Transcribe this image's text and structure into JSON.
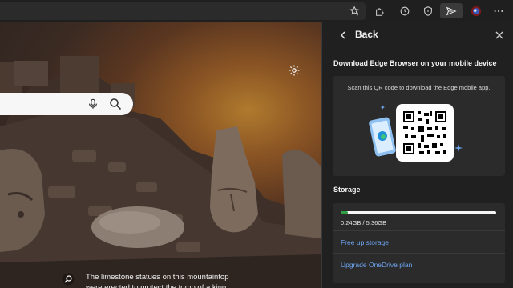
{
  "toolbar": {
    "icons": [
      "favorites-star-icon",
      "extensions-icon",
      "history-icon",
      "browser-essentials-icon",
      "send-share-icon",
      "profile-icon",
      "more-icon"
    ]
  },
  "newtab": {
    "caption": "The limestone statues on this mountaintop were erected to protect the tomb of a king."
  },
  "panel": {
    "back_label": "Back",
    "download_title": "Download Edge Browser on your mobile device",
    "scan_text": "Scan this QR code to download the Edge mobile app.",
    "storage_title": "Storage",
    "storage_usage": "0.24GB / 5.36GB",
    "storage_fraction": 0.045,
    "free_up_link": "Free up storage",
    "upgrade_link": "Upgrade OneDrive plan"
  },
  "colors": {
    "accent_link": "#6fa8f5",
    "storage_bar": "#2ea043",
    "panel_bg": "#202020"
  }
}
